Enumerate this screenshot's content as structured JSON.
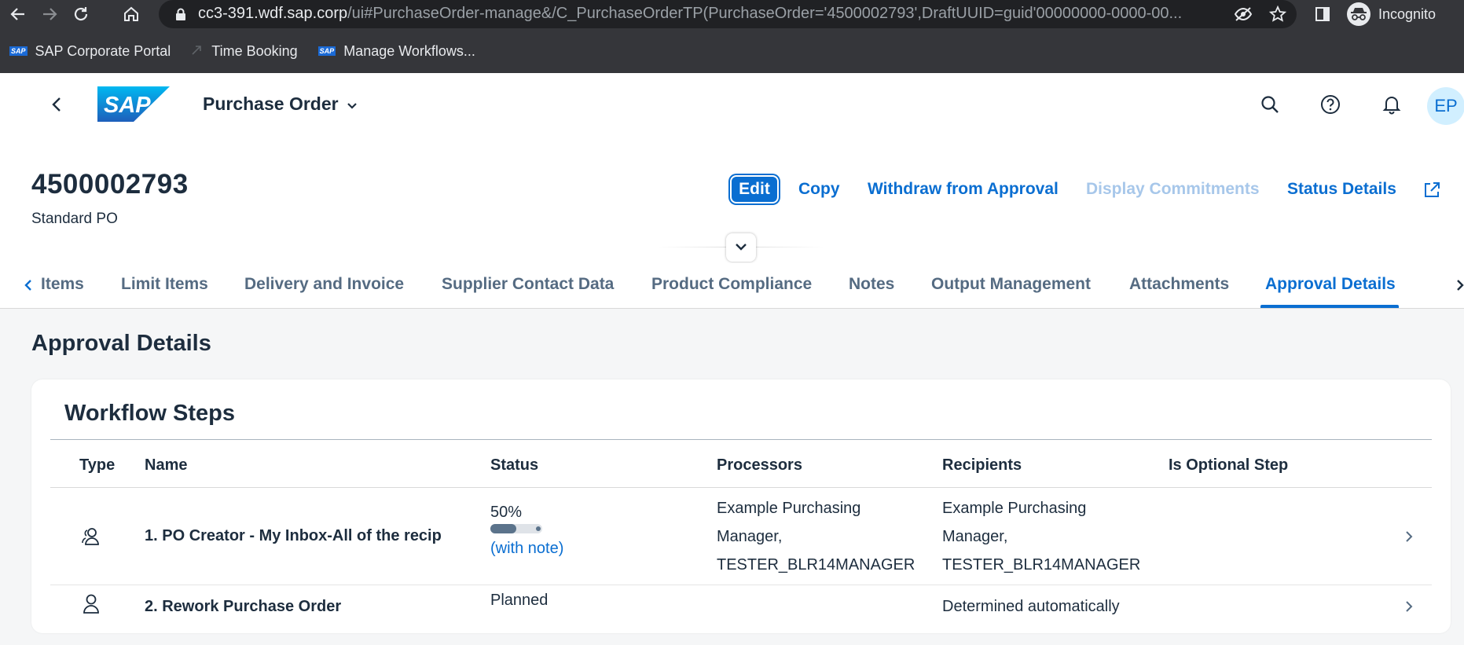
{
  "browser": {
    "url_host": "cc3-391.wdf.sap.corp",
    "url_path": "/ui#PurchaseOrder-manage&/C_PurchaseOrderTP(PurchaseOrder='4500002793',DraftUUID=guid'00000000-0000-00...",
    "profile_label": "Incognito",
    "bookmarks": [
      {
        "label": "SAP Corporate Portal",
        "icon": "sap-logo-icon"
      },
      {
        "label": "Time Booking",
        "icon": "arrow-icon"
      },
      {
        "label": "Manage Workflows...",
        "icon": "sap-logo-icon"
      }
    ]
  },
  "shell": {
    "logo_text": "SAP",
    "app_title": "Purchase Order",
    "user_initials": "EP",
    "brand_color": "#0a6ed1"
  },
  "header": {
    "title": "4500002793",
    "subtitle": "Standard PO",
    "actions": {
      "edit": "Edit",
      "copy": "Copy",
      "withdraw": "Withdraw from Approval",
      "display_commitments": "Display Commitments",
      "status_details": "Status Details"
    }
  },
  "tabs": [
    {
      "label": "Items",
      "active": false
    },
    {
      "label": "Limit Items",
      "active": false
    },
    {
      "label": "Delivery and Invoice",
      "active": false
    },
    {
      "label": "Supplier Contact Data",
      "active": false
    },
    {
      "label": "Product Compliance",
      "active": false
    },
    {
      "label": "Notes",
      "active": false
    },
    {
      "label": "Output Management",
      "active": false
    },
    {
      "label": "Attachments",
      "active": false
    },
    {
      "label": "Approval Details",
      "active": true
    }
  ],
  "section": {
    "title": "Approval Details",
    "card_title": "Workflow Steps",
    "columns": [
      "Type",
      "Name",
      "Status",
      "Processors",
      "Recipients",
      "Is Optional Step"
    ],
    "rows": [
      {
        "type_icon": "group-icon",
        "name": "1. PO Creator - My Inbox-All of the recip",
        "status_percent": "50%",
        "status_progress": 0.5,
        "status_note": "(with note)",
        "processors": [
          "Example Purchasing",
          "Manager,",
          "TESTER_BLR14MANAGER"
        ],
        "recipients": [
          "Example Purchasing",
          "Manager,",
          "TESTER_BLR14MANAGER"
        ],
        "is_optional": ""
      },
      {
        "type_icon": "person-icon",
        "name": "2. Rework Purchase Order",
        "status_text": "Planned",
        "processors": [],
        "recipients": [
          "Determined automatically"
        ],
        "is_optional": ""
      }
    ]
  }
}
